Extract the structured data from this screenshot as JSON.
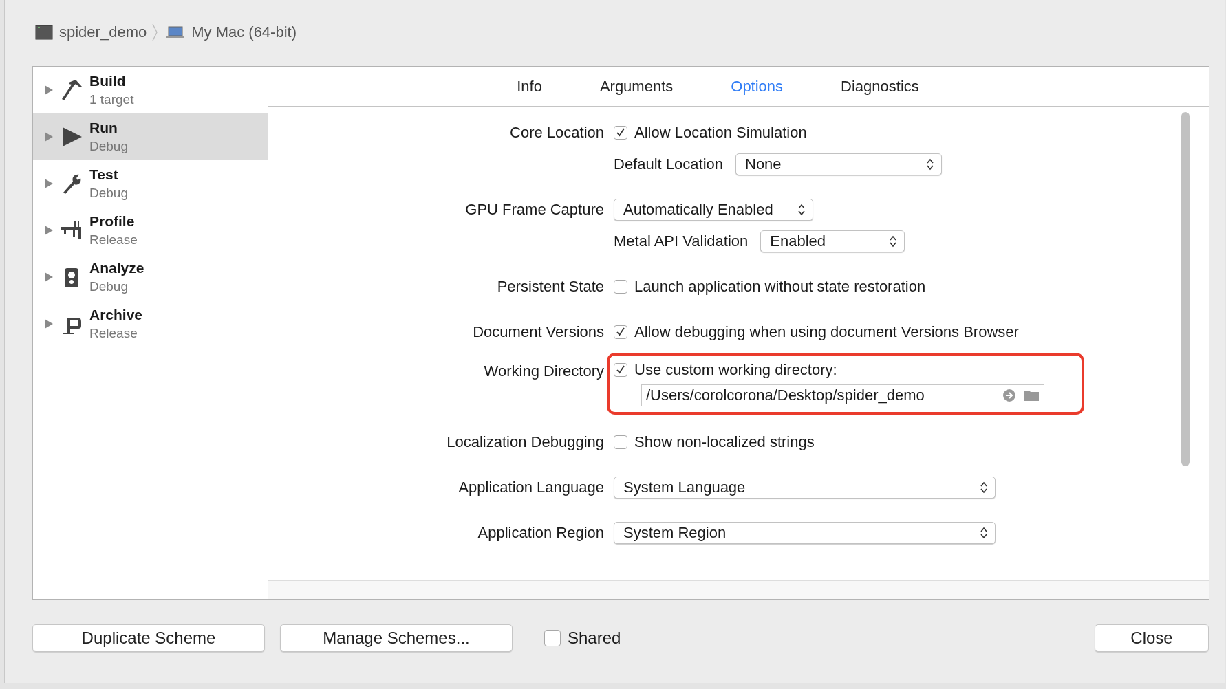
{
  "breadcrumb": [
    {
      "kind": "project",
      "label": "spider_demo"
    },
    {
      "kind": "device",
      "label": "My Mac (64-bit)"
    }
  ],
  "sidebar": {
    "items": [
      {
        "kind": "hammer",
        "title": "Build",
        "subtitle": "1 target",
        "selected": false
      },
      {
        "kind": "play",
        "title": "Run",
        "subtitle": "Debug",
        "selected": true
      },
      {
        "kind": "wrench",
        "title": "Test",
        "subtitle": "Debug",
        "selected": false
      },
      {
        "kind": "caliper",
        "title": "Profile",
        "subtitle": "Release",
        "selected": false
      },
      {
        "kind": "meter",
        "title": "Analyze",
        "subtitle": "Debug",
        "selected": false
      },
      {
        "kind": "clamp",
        "title": "Archive",
        "subtitle": "Release",
        "selected": false
      }
    ]
  },
  "tabs": [
    {
      "label": "Info",
      "selected": false
    },
    {
      "label": "Arguments",
      "selected": false
    },
    {
      "label": "Options",
      "selected": true
    },
    {
      "label": "Diagnostics",
      "selected": false
    }
  ],
  "options": [
    {
      "kind": "checkbox",
      "label": "Core Location",
      "text": "Allow Location Simulation",
      "checked": true,
      "highlighted": false
    },
    {
      "kind": "select",
      "sublabel": "Default Location",
      "value": "None",
      "highlighted": false
    },
    {
      "kind": "select",
      "label": "GPU Frame Capture",
      "value": "Automatically Enabled",
      "highlighted": false
    },
    {
      "kind": "select",
      "sublabel": "Metal API Validation",
      "value": "Enabled",
      "highlighted": false
    },
    {
      "kind": "checkbox",
      "label": "Persistent State",
      "text": "Launch application without state restoration",
      "checked": false,
      "highlighted": false
    },
    {
      "kind": "checkbox",
      "label": "Document Versions",
      "text": "Allow debugging when using document Versions Browser",
      "checked": true,
      "highlighted": false
    },
    {
      "kind": "path",
      "label": "Working Directory",
      "text": "Use custom working directory:",
      "checked": true,
      "value": "/Users/corolcorona/Desktop/spider_demo",
      "highlighted": true
    },
    {
      "kind": "checkbox",
      "label": "Localization Debugging",
      "text": "Show non-localized strings",
      "checked": false,
      "highlighted": false
    },
    {
      "kind": "select",
      "label": "Application Language",
      "value": "System Language",
      "highlighted": false
    },
    {
      "kind": "select",
      "label": "Application Region",
      "value": "System Region",
      "highlighted": false
    }
  ],
  "footer": {
    "buttons": [
      {
        "label": "Duplicate Scheme"
      },
      {
        "label": "Manage Schemes..."
      }
    ],
    "shared": {
      "label": "Shared",
      "checked": false
    },
    "close": {
      "label": "Close"
    }
  }
}
